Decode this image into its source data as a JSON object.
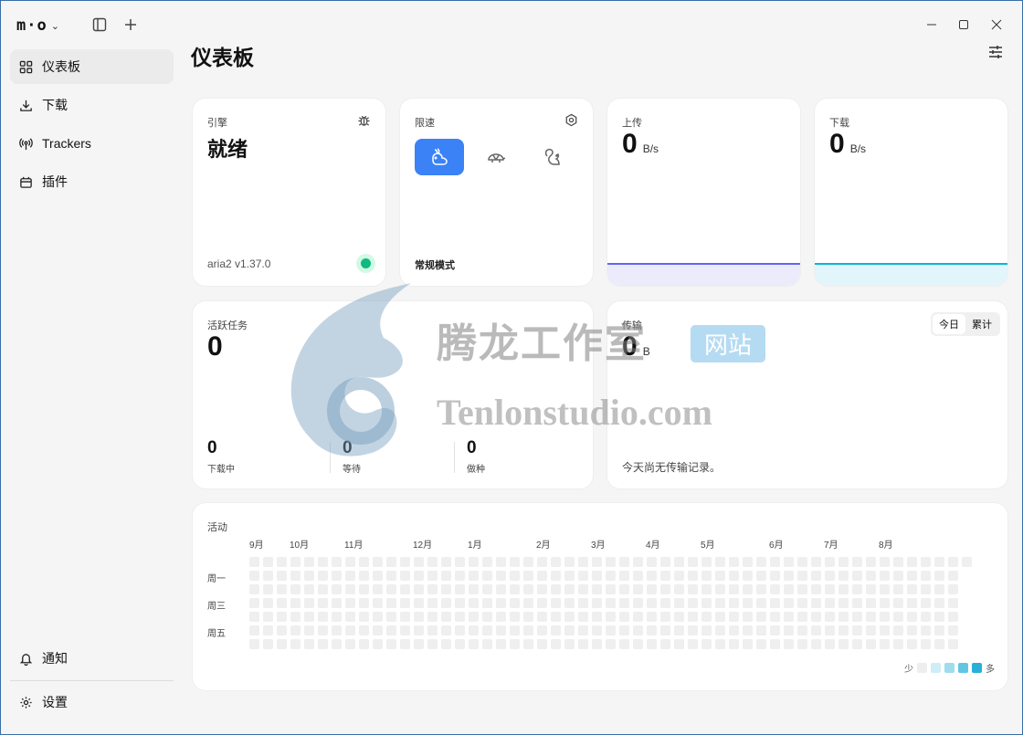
{
  "app": {
    "logo": "m·o"
  },
  "sidebar": {
    "items": [
      {
        "label": "仪表板",
        "icon": "dashboard-icon"
      },
      {
        "label": "下载",
        "icon": "download-icon"
      },
      {
        "label": "Trackers",
        "icon": "broadcast-icon"
      },
      {
        "label": "插件",
        "icon": "plugin-icon"
      }
    ],
    "bottom": [
      {
        "label": "通知",
        "icon": "bell-icon"
      },
      {
        "label": "设置",
        "icon": "gear-icon"
      }
    ]
  },
  "page": {
    "title": "仪表板"
  },
  "engine": {
    "label": "引擎",
    "status": "就绪",
    "version": "aria2 v1.37.0",
    "status_color": "#10b981"
  },
  "speed_limit": {
    "label": "限速",
    "mode": "常规模式",
    "modes": [
      "rabbit-icon",
      "turtle-icon",
      "squirrel-icon"
    ],
    "active": 0,
    "accent": "#3b82f6"
  },
  "upload": {
    "label": "上传",
    "value": "0",
    "unit": "B/s",
    "color": "#6366f1"
  },
  "download": {
    "label": "下载",
    "value": "0",
    "unit": "B/s",
    "color": "#06b6d4"
  },
  "tasks": {
    "label": "活跃任务",
    "value": "0",
    "stats": [
      {
        "value": "0",
        "label": "下载中"
      },
      {
        "value": "0",
        "label": "等待"
      },
      {
        "value": "0",
        "label": "做种"
      }
    ]
  },
  "transfer": {
    "label": "传输",
    "value": "0",
    "unit": "B",
    "empty": "今天尚无传输记录。",
    "tabs": [
      "今日",
      "累计"
    ],
    "active_tab": 0
  },
  "activity": {
    "label": "活动",
    "months": [
      "9月",
      "10月",
      "11月",
      "12月",
      "1月",
      "2月",
      "3月",
      "4月",
      "5月",
      "6月",
      "7月",
      "8月"
    ],
    "days": [
      "周一",
      "周三",
      "周五"
    ],
    "legend_less": "少",
    "legend_more": "多",
    "legend_colors": [
      "#eeeeee",
      "#cdeef6",
      "#9fdcee",
      "#62c6e3",
      "#28b0d8"
    ]
  },
  "watermark": {
    "title": "腾龙工作室",
    "badge": "网站",
    "url": "Tenlonstudio.com"
  }
}
